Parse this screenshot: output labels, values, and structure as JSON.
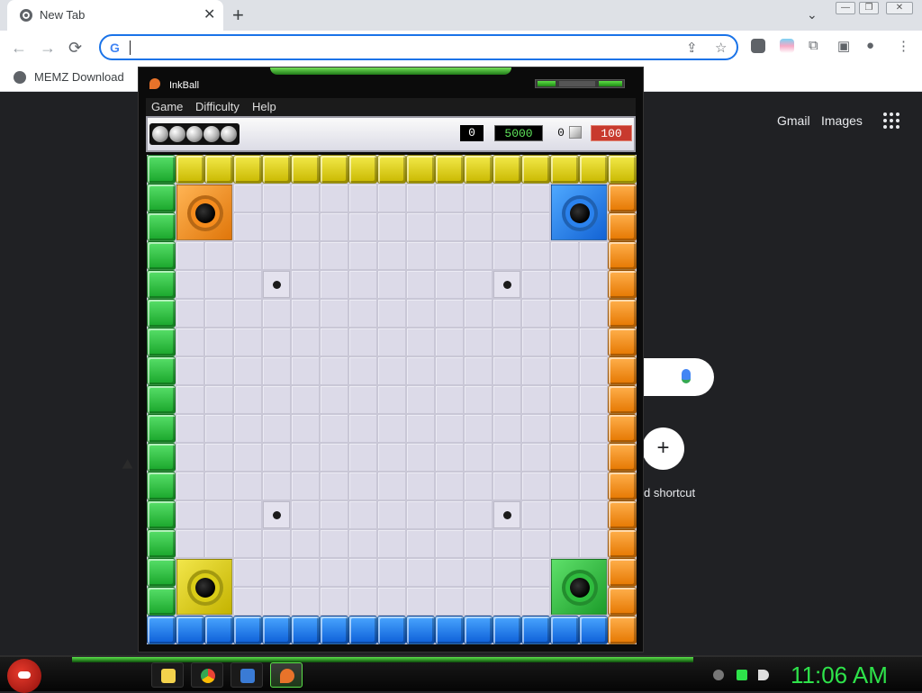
{
  "browser": {
    "tab_title": "New Tab",
    "tab_close": "✕",
    "new_tab": "+",
    "tab_search": "⌄",
    "win_minimize": "—",
    "win_restore": "❐",
    "win_close": "✕",
    "back": "←",
    "forward": "→",
    "reload": "⟳",
    "omnibox_icon": "G",
    "omnibox_value": "",
    "share": "⇪",
    "star": "☆",
    "extensions": "⧉",
    "side_panel": "▣",
    "profile": "●",
    "menu": "⋮",
    "bookmark": "MEMZ Download"
  },
  "ntp": {
    "gmail": "Gmail",
    "images": "Images",
    "add_shortcut": "+",
    "shortcut_label": "d shortcut"
  },
  "inkball": {
    "title": "InkBall",
    "menu": [
      "Game",
      "Difficulty",
      "Help"
    ],
    "balls_remaining": 5,
    "score": "0",
    "timer": "5000",
    "ink_used": "0",
    "target": "100",
    "board": {
      "cols": 17,
      "rows": 17,
      "top_walls": [
        "green",
        "yellow",
        "yellow",
        "yellow",
        "yellow",
        "yellow",
        "yellow",
        "yellow",
        "yellow",
        "yellow",
        "yellow",
        "yellow",
        "yellow",
        "yellow",
        "yellow",
        "yellow",
        "yellow"
      ],
      "bottom_walls": [
        "blue",
        "blue",
        "blue",
        "blue",
        "blue",
        "blue",
        "blue",
        "blue",
        "blue",
        "blue",
        "blue",
        "blue",
        "blue",
        "blue",
        "blue",
        "blue",
        "orange"
      ],
      "left_walls": "green",
      "right_walls": "orange",
      "holes": [
        {
          "color": "orange",
          "col": 1,
          "row": 1
        },
        {
          "color": "blue",
          "col": 14,
          "row": 1
        },
        {
          "color": "yellow",
          "col": 1,
          "row": 14
        },
        {
          "color": "green",
          "col": 14,
          "row": 14
        }
      ],
      "spawners": [
        {
          "col": 4,
          "row": 4
        },
        {
          "col": 12,
          "row": 4
        },
        {
          "col": 4,
          "row": 12
        },
        {
          "col": 12,
          "row": 12
        }
      ]
    },
    "colors": {
      "yellow": "#e0d21a",
      "green": "#2fc33e",
      "orange": "#f58b1c",
      "blue": "#1f7be8"
    }
  },
  "taskbar": {
    "clock": "11:06 AM",
    "apps": [
      "folder-icon",
      "chrome-icon",
      "network-icon",
      "inkball-icon"
    ]
  }
}
